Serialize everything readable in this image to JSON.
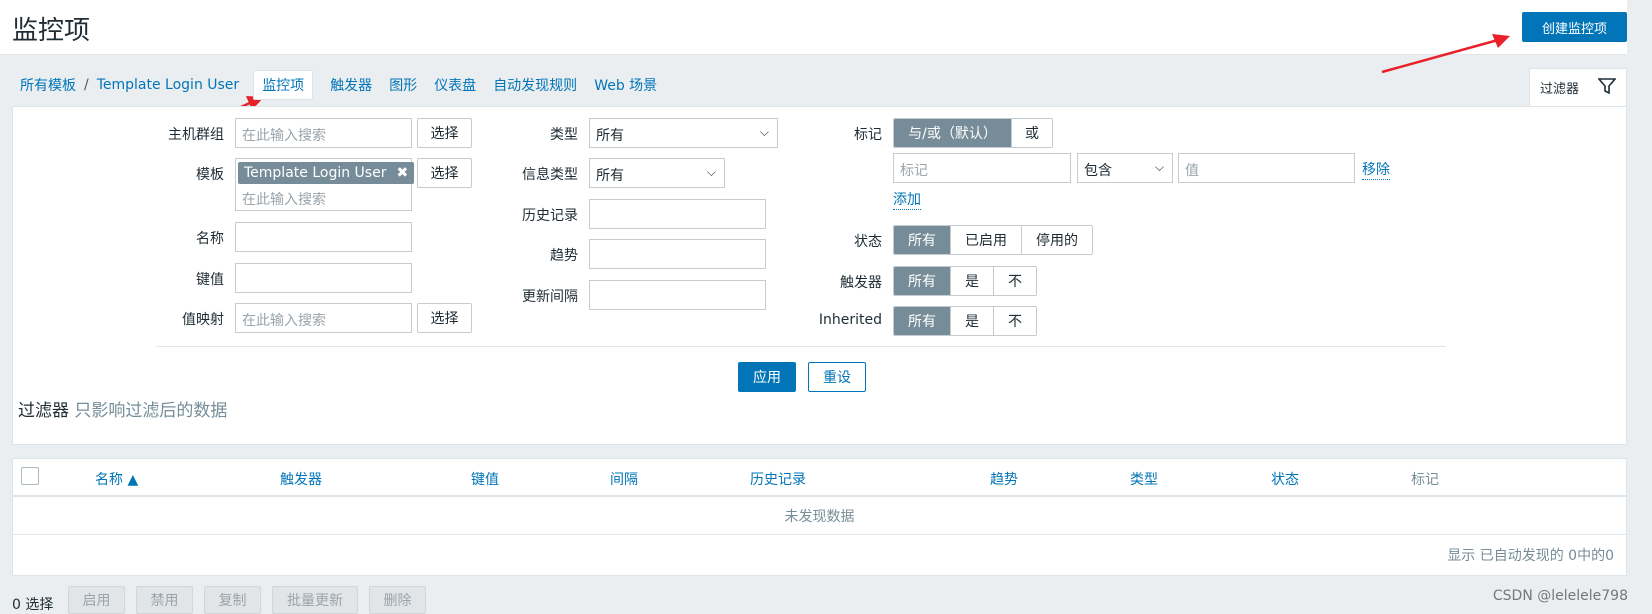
{
  "header": {
    "title": "监控项",
    "create_button": "创建监控项"
  },
  "breadcrumb": {
    "all_templates": "所有模板",
    "separator": "/",
    "template": "Template Login User"
  },
  "tabs": [
    "监控项",
    "触发器",
    "图形",
    "仪表盘",
    "自动发现规则",
    "Web 场景"
  ],
  "filter_tab": {
    "label": "过滤器",
    "icon": "funnel-icon"
  },
  "filter": {
    "host_group": {
      "label": "主机群组",
      "placeholder": "在此输入搜索",
      "select": "选择"
    },
    "template": {
      "label": "模板",
      "tag": "Template Login User",
      "placeholder": "在此输入搜索",
      "select": "选择"
    },
    "name": {
      "label": "名称",
      "value": ""
    },
    "key": {
      "label": "键值",
      "value": ""
    },
    "valuemap": {
      "label": "值映射",
      "placeholder": "在此输入搜索",
      "select": "选择"
    },
    "type": {
      "label": "类型",
      "value": "所有"
    },
    "info_type": {
      "label": "信息类型",
      "value": "所有"
    },
    "history": {
      "label": "历史记录",
      "value": ""
    },
    "trends": {
      "label": "趋势",
      "value": ""
    },
    "update_interval": {
      "label": "更新间隔",
      "value": ""
    },
    "tags": {
      "label": "标记",
      "and_or": "与/或（默认）",
      "or": "或",
      "tag_placeholder": "标记",
      "operator": "包含",
      "value_placeholder": "值",
      "remove": "移除",
      "add": "添加"
    },
    "status": {
      "label": "状态",
      "options": [
        "所有",
        "已启用",
        "停用的"
      ]
    },
    "triggers": {
      "label": "触发器",
      "options": [
        "所有",
        "是",
        "不"
      ]
    },
    "inherited": {
      "label": "Inherited",
      "options": [
        "所有",
        "是",
        "不"
      ]
    },
    "apply": "应用",
    "reset": "重设",
    "note_prefix": "过滤器",
    "note_text": "只影响过滤后的数据"
  },
  "table": {
    "columns": [
      "名称 ▲",
      "触发器",
      "键值",
      "间隔",
      "历史记录",
      "趋势",
      "类型",
      "状态",
      "标记"
    ],
    "no_data": "未发现数据",
    "footer": "显示 已自动发现的 0中的0"
  },
  "bottom": {
    "selected": "0 选择",
    "buttons": [
      "启用",
      "禁用",
      "复制",
      "批量更新",
      "删除"
    ]
  },
  "watermark": "CSDN @lelelele798",
  "colors": {
    "primary": "#0275b8",
    "segment_on": "#768d99",
    "annotation_arrow": "#e8202a"
  }
}
